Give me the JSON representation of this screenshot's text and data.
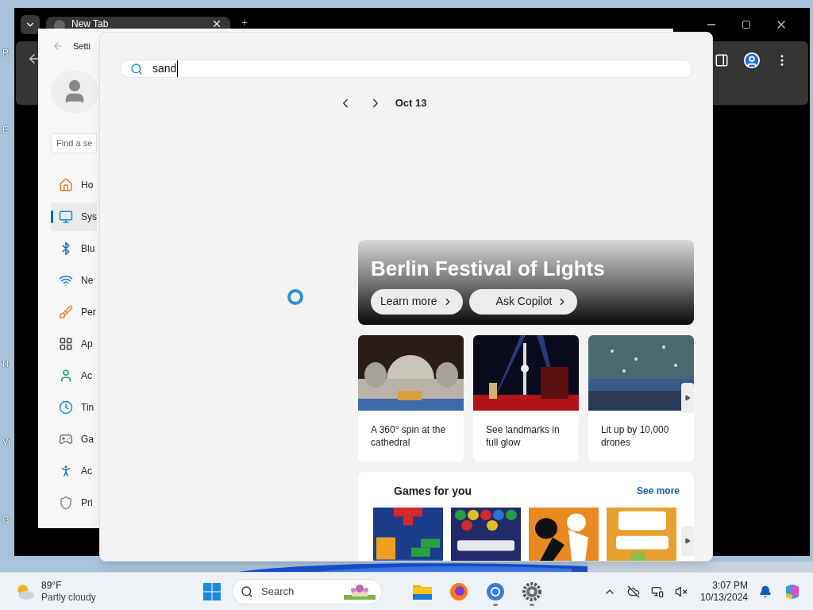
{
  "desktop": {
    "icon_labels": [
      "R",
      "E",
      "N",
      "Vi",
      "G"
    ]
  },
  "browser": {
    "tab_title": "New Tab",
    "new_tab": "+"
  },
  "settings": {
    "title": "Setti",
    "search_placeholder": "Find a se",
    "nav": [
      {
        "label": "Ho",
        "selected": false
      },
      {
        "label": "Sys",
        "selected": true
      },
      {
        "label": "Blu",
        "selected": false
      },
      {
        "label": "Ne",
        "selected": false
      },
      {
        "label": "Per",
        "selected": false
      },
      {
        "label": "Ap",
        "selected": false
      },
      {
        "label": "Ac",
        "selected": false
      },
      {
        "label": "Tin",
        "selected": false
      },
      {
        "label": "Ga",
        "selected": false
      },
      {
        "label": "Ac",
        "selected": false
      },
      {
        "label": "Pri",
        "selected": false
      }
    ]
  },
  "widgets": {
    "search": {
      "value": "sand"
    },
    "date": "Oct 13",
    "hero": {
      "title": "Berlin Festival of Lights",
      "buttons": [
        "Learn more",
        "Ask Copilot"
      ]
    },
    "articles": [
      {
        "caption": "A 360° spin at the cathedral"
      },
      {
        "caption": "See landmarks in full glow"
      },
      {
        "caption": "Lit up by 10,000 drones"
      }
    ],
    "games": {
      "title": "Games for you",
      "link": "See more"
    }
  },
  "taskbar": {
    "weather": {
      "temp": "89°F",
      "condition": "Partly cloudy"
    },
    "search_placeholder": "Search",
    "time": "3:07 PM",
    "date": "10/13/2024"
  }
}
